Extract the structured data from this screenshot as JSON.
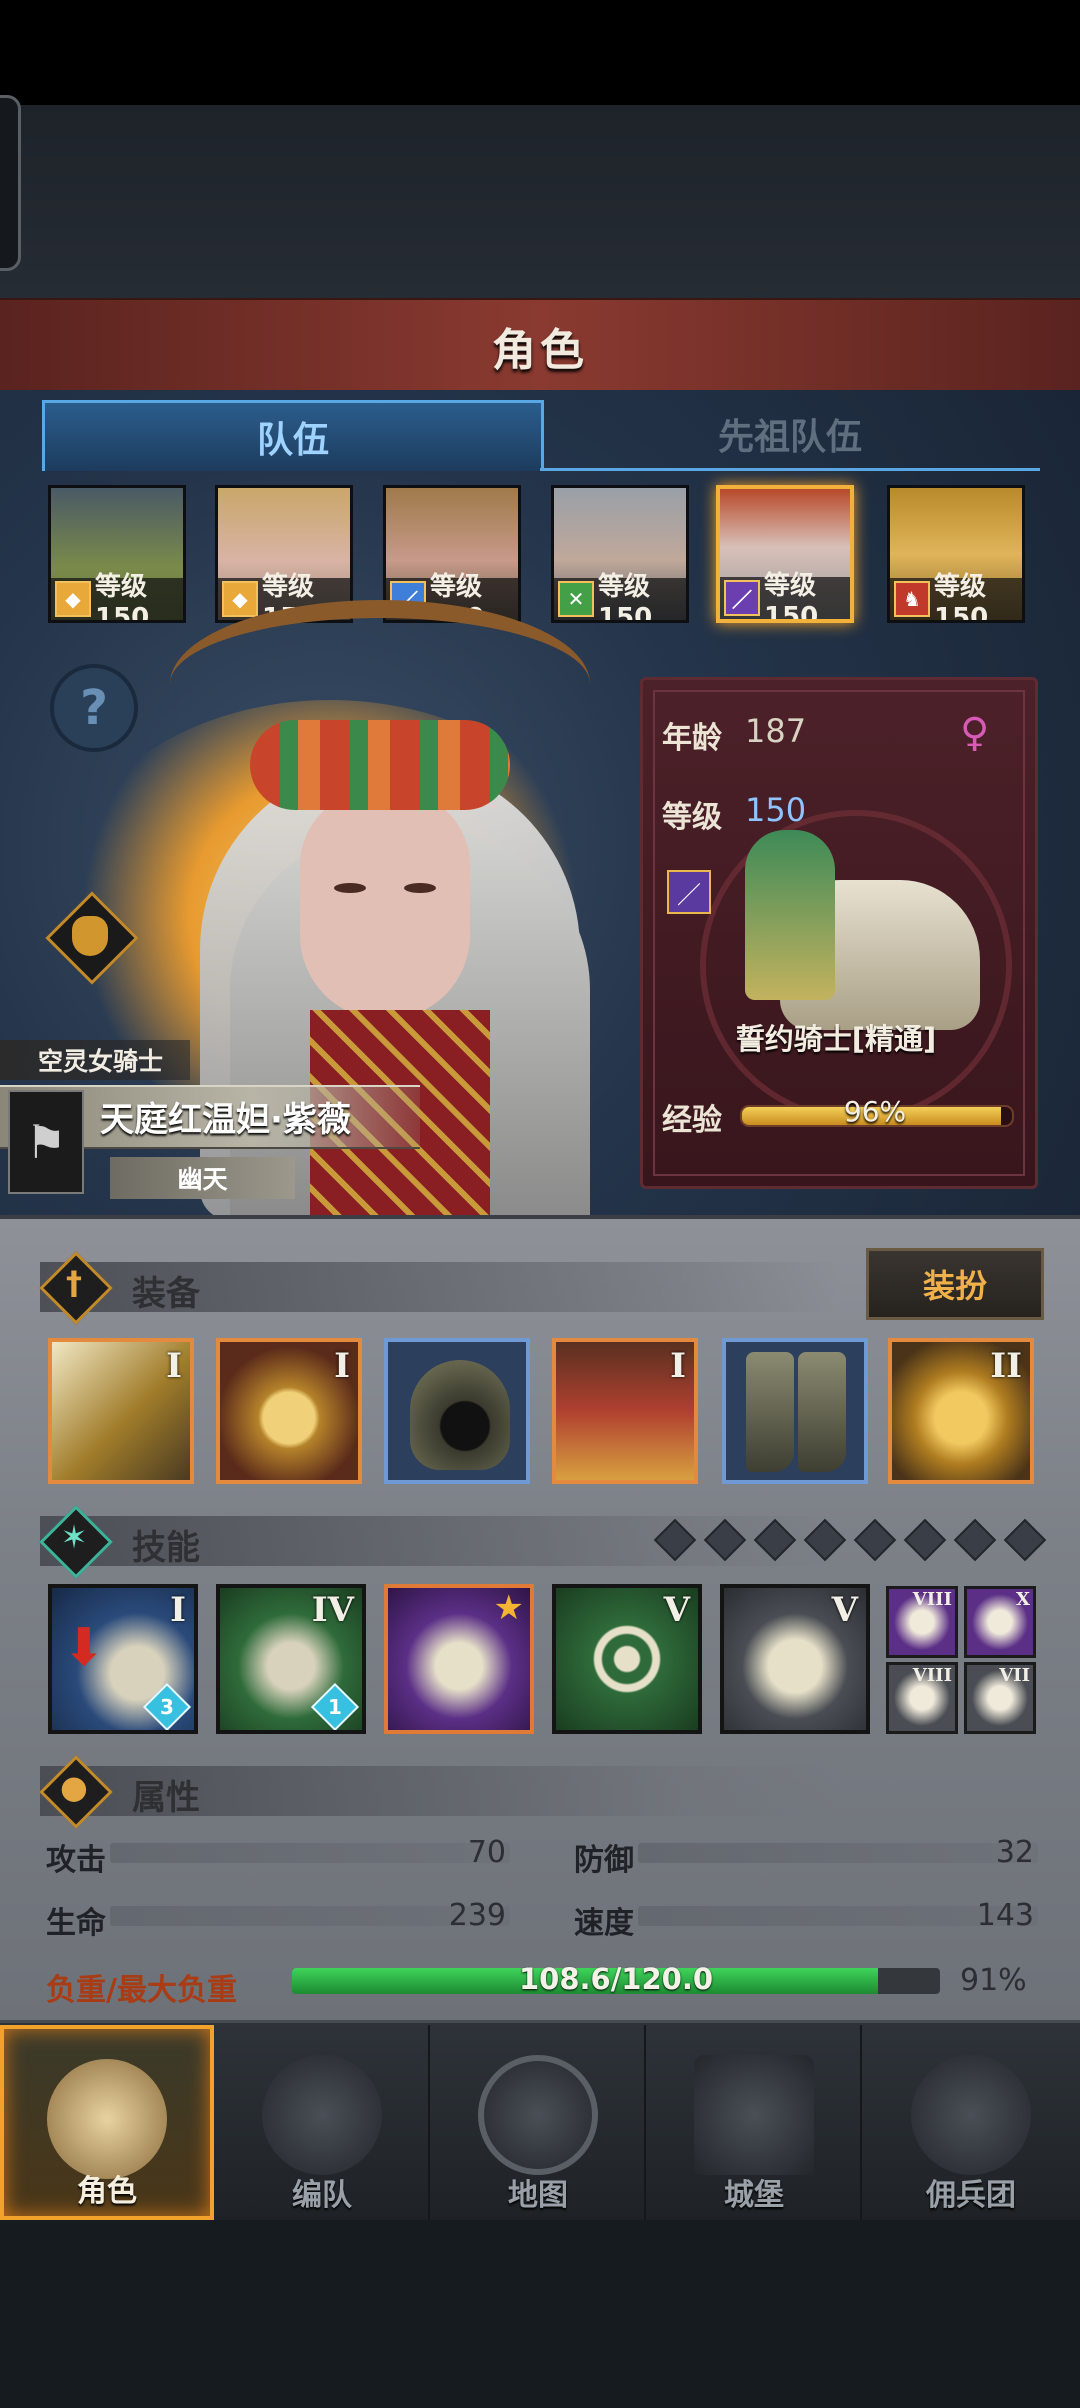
{
  "header": {
    "title": "角色"
  },
  "tabs": [
    {
      "label": "队伍",
      "active": true
    },
    {
      "label": "先祖队伍",
      "active": false
    }
  ],
  "team": [
    {
      "level_text": "等级150",
      "class_icon": "shield-icon",
      "accent": "#e8a93a"
    },
    {
      "level_text": "等级150",
      "class_icon": "shield-icon",
      "accent": "#e8a93a"
    },
    {
      "level_text": "等级150",
      "class_icon": "sword-icon",
      "accent": "#3f7fd9"
    },
    {
      "level_text": "等级150",
      "class_icon": "bow-icon",
      "accent": "#43a047"
    },
    {
      "level_text": "等级150",
      "class_icon": "staff-icon",
      "accent": "#6b3fb0",
      "selected": true
    },
    {
      "level_text": "等级150",
      "class_icon": "horse-icon",
      "accent": "#c0392b"
    }
  ],
  "hero": {
    "class_name": "空灵女骑士",
    "name": "天庭红温妲·紫薇",
    "title": "幽天"
  },
  "info": {
    "age_label": "年龄",
    "age_value": "187",
    "level_label": "等级",
    "level_value": "150",
    "gender_icon": "female-icon",
    "mount_name": "誓约骑士[精通]",
    "exp_label": "经验",
    "exp_text": "96%",
    "exp_fraction": 0.96
  },
  "equipment": {
    "title": "装备",
    "dress_button": "装扮",
    "items": [
      {
        "name": "sword",
        "tier": "I",
        "rarity": "orange"
      },
      {
        "name": "tome",
        "tier": "I",
        "rarity": "orange"
      },
      {
        "name": "hood",
        "tier": "",
        "rarity": "blue"
      },
      {
        "name": "armor",
        "tier": "I",
        "rarity": "orange"
      },
      {
        "name": "boots",
        "tier": "",
        "rarity": "blue"
      },
      {
        "name": "amulet",
        "tier": "II",
        "rarity": "orange"
      }
    ]
  },
  "skills": {
    "title": "技能",
    "slots_total": 8,
    "items": [
      {
        "name": "lance-strike",
        "tier": "I",
        "badge": "3",
        "bg": "#2a4a7a"
      },
      {
        "name": "charge",
        "tier": "IV",
        "badge": "1",
        "bg": "#2f6b3a"
      },
      {
        "name": "shatter",
        "tier": "",
        "badge": "",
        "bg": "#5b2f86",
        "starred": true
      },
      {
        "name": "target",
        "tier": "V",
        "badge": "",
        "bg": "#2f6b3a"
      },
      {
        "name": "crystal-shield",
        "tier": "V",
        "badge": "",
        "bg": "#3c3f44"
      }
    ],
    "mini": [
      {
        "name": "burst",
        "tier": "VIII",
        "bg": "#5b2f86"
      },
      {
        "name": "shield",
        "tier": "X",
        "bg": "#5b2f86"
      },
      {
        "name": "nova",
        "tier": "VIII",
        "bg": "#3c3f44"
      },
      {
        "name": "heal",
        "tier": "VII",
        "bg": "#3c3f44"
      }
    ]
  },
  "attributes": {
    "title": "属性",
    "stats": [
      {
        "label": "攻击",
        "value": "70"
      },
      {
        "label": "防御",
        "value": "32"
      },
      {
        "label": "生命",
        "value": "239"
      },
      {
        "label": "速度",
        "value": "143"
      }
    ],
    "load_label": "负重/最大负重",
    "load_text": "108.6/120.0",
    "load_pct": "91%",
    "load_fraction": 0.905
  },
  "nav": [
    {
      "label": "角色",
      "icon": "knight-icon",
      "active": true
    },
    {
      "label": "编队",
      "icon": "helmet-icon",
      "active": false
    },
    {
      "label": "地图",
      "icon": "compass-icon",
      "active": false
    },
    {
      "label": "城堡",
      "icon": "castle-icon",
      "active": false
    },
    {
      "label": "佣兵团",
      "icon": "mercenary-icon",
      "active": false
    }
  ]
}
